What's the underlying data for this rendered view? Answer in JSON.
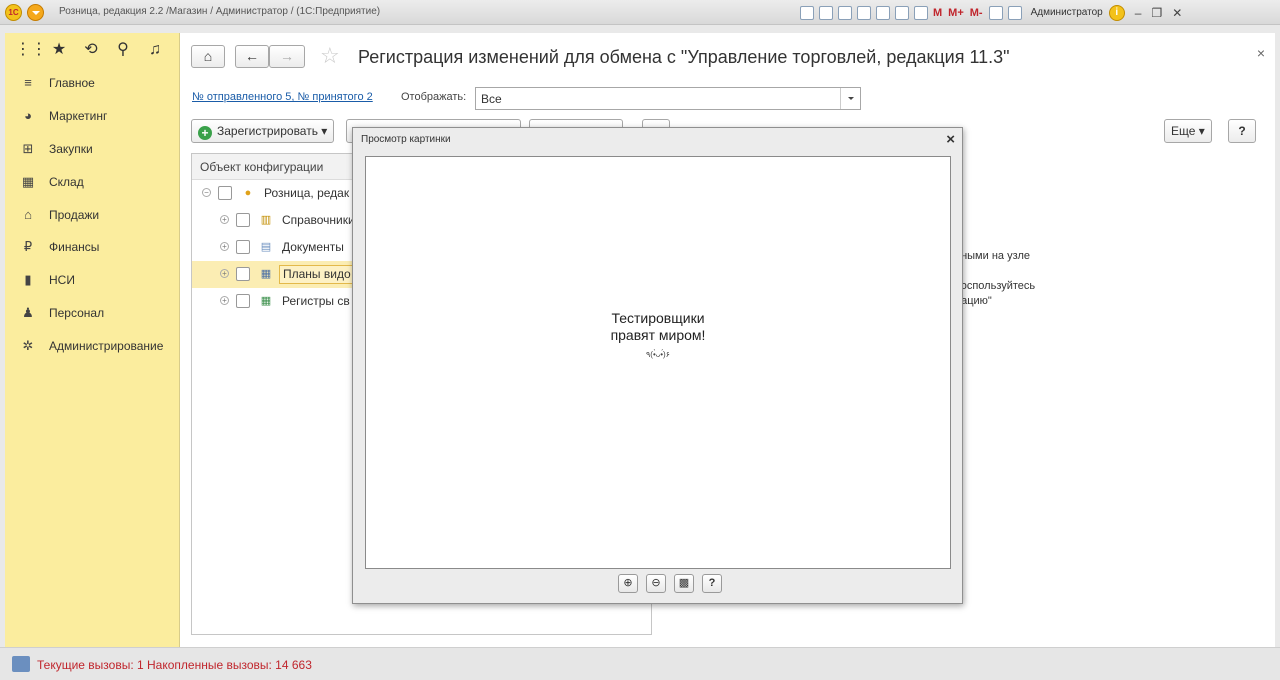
{
  "titlebar": {
    "logo": "1С",
    "title": "Розница, редакция 2.2 /Магазин / Администратор / (1С:Предприятие)",
    "m1": "M",
    "m2": "M+",
    "m3": "M-",
    "user": "Администратор",
    "info": "i"
  },
  "sidebar": {
    "items": [
      {
        "label": "Главное"
      },
      {
        "label": "Маркетинг"
      },
      {
        "label": "Закупки"
      },
      {
        "label": "Склад"
      },
      {
        "label": "Продажи"
      },
      {
        "label": "Финансы"
      },
      {
        "label": "НСИ"
      },
      {
        "label": "Персонал"
      },
      {
        "label": "Администрирование"
      }
    ]
  },
  "header": {
    "title": "Регистрация изменений для обмена с  \"Управление торговлей, редакция 11.3\""
  },
  "filter": {
    "link": "№ отправленного 5, № принятого 2",
    "show_label": "Отображать:",
    "show_value": "Все"
  },
  "toolbar": {
    "register": "Зарегистрировать",
    "more": "Еще",
    "help": "?"
  },
  "tree": {
    "header": "Объект конфигурации",
    "root": "Розница, редак",
    "items": [
      {
        "label": "Справочники"
      },
      {
        "label": "Документы"
      },
      {
        "label": "Планы видо"
      },
      {
        "label": "Регистры св"
      }
    ]
  },
  "info": {
    "line1": "нными на узле",
    "line2": "воспользуйтесь",
    "line3": "рацию\""
  },
  "modal": {
    "title": "Просмотр картинки",
    "close": "×",
    "picture_line1": "Тестировщики",
    "picture_line2": "правят миром!",
    "picture_face": "٩(•̀ᴗ•́)۶",
    "help": "?"
  },
  "status": {
    "text": "Текущие вызовы: 1   Накопленные вызовы: 14 663"
  },
  "colors": {
    "sidebar_bg": "#fbed9e",
    "selected_row": "#fbedb3",
    "status_text": "#c0262d",
    "link": "#1a5ca8",
    "add_icon": "#3aa14a"
  }
}
